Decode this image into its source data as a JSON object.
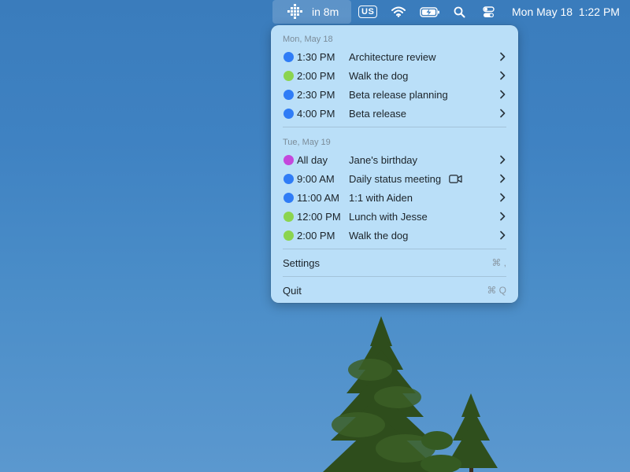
{
  "menubar": {
    "app_status": "in 8m",
    "input_source": "US",
    "datetime": "Mon May 18  1:22 PM",
    "icons": [
      "calendar-app-icon",
      "wifi-icon",
      "battery-charging-icon",
      "search-icon",
      "control-center-icon"
    ]
  },
  "colors": {
    "blue": "#2f7cf6",
    "green": "#8bd44f",
    "purple": "#c447dc"
  },
  "days": [
    {
      "header": "Mon, May 18",
      "events": [
        {
          "time": "1:30 PM",
          "title": "Architecture review",
          "color": "blue"
        },
        {
          "time": "2:00 PM",
          "title": "Walk the dog",
          "color": "green"
        },
        {
          "time": "2:30 PM",
          "title": "Beta release planning",
          "color": "blue"
        },
        {
          "time": "4:00 PM",
          "title": "Beta release",
          "color": "blue"
        }
      ]
    },
    {
      "header": "Tue, May 19",
      "events": [
        {
          "time": "All day",
          "title": "Jane's birthday",
          "color": "purple"
        },
        {
          "time": "9:00 AM",
          "title": "Daily status meeting",
          "color": "blue",
          "icon": "video-camera-icon"
        },
        {
          "time": "11:00 AM",
          "title": "1:1 with Aiden",
          "color": "blue"
        },
        {
          "time": "12:00 PM",
          "title": "Lunch with Jesse",
          "color": "green"
        },
        {
          "time": "2:00 PM",
          "title": "Walk the dog",
          "color": "green"
        }
      ]
    }
  ],
  "menu": {
    "settings_label": "Settings",
    "settings_shortcut": "⌘ ,",
    "quit_label": "Quit",
    "quit_shortcut": "⌘ Q"
  }
}
